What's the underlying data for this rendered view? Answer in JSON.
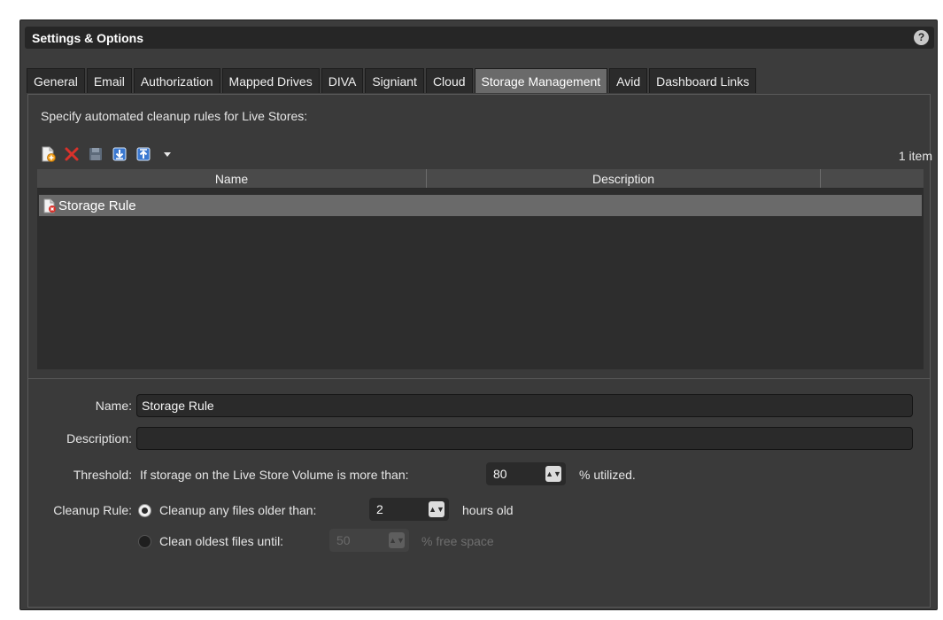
{
  "window": {
    "title": "Settings & Options",
    "help_label": "?"
  },
  "tabs": [
    {
      "label": "General",
      "active": false
    },
    {
      "label": "Email",
      "active": false
    },
    {
      "label": "Authorization",
      "active": false
    },
    {
      "label": "Mapped Drives",
      "active": false
    },
    {
      "label": "DIVA",
      "active": false
    },
    {
      "label": "Signiant",
      "active": false
    },
    {
      "label": "Cloud",
      "active": false
    },
    {
      "label": "Storage Management",
      "active": true
    },
    {
      "label": "Avid",
      "active": false
    },
    {
      "label": "Dashboard Links",
      "active": false
    }
  ],
  "storage": {
    "instruction": "Specify automated cleanup rules for Live Stores:",
    "toolbar": {
      "icons": [
        "new-rule-icon",
        "delete-icon",
        "save-icon",
        "import-icon",
        "export-icon",
        "dropdown-icon"
      ]
    },
    "item_count": "1 item",
    "grid": {
      "columns": [
        "Name",
        "Description"
      ],
      "rows": [
        {
          "name": "Storage Rule",
          "description": ""
        }
      ]
    },
    "details": {
      "name_label": "Name:",
      "name_value": "Storage Rule",
      "description_label": "Description:",
      "description_value": "",
      "threshold_label": "Threshold:",
      "threshold_prefix": "If storage on the Live Store Volume is more than:",
      "threshold_value": "80",
      "threshold_suffix": "% utilized.",
      "cleanup_label": "Cleanup Rule:",
      "option1_label": "Cleanup any files older than:",
      "option1_value": "2",
      "option1_suffix": "hours  old",
      "option1_selected": true,
      "option2_label": "Clean oldest files until:",
      "option2_value": "50",
      "option2_suffix": "% free space",
      "option2_selected": false
    }
  },
  "colors": {
    "background": "#3c3c3c",
    "titlebar": "#262626",
    "active_tab": "#6a6a6a",
    "delete_red": "#d9322b",
    "arrow_blue": "#3a78d0"
  }
}
